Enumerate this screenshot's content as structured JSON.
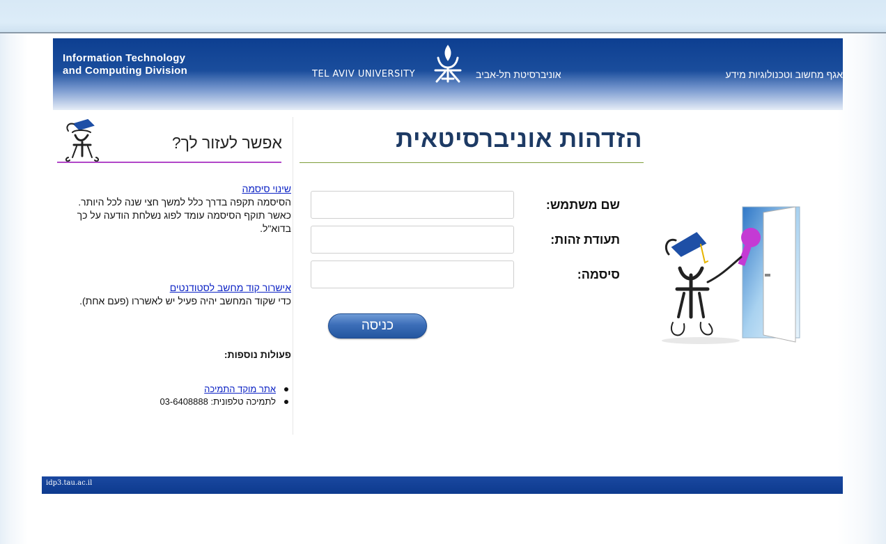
{
  "header": {
    "division_en_line1": "Information Technology",
    "division_en_line2": "and Computing Division",
    "university_en": "TEL AVIV UNIVERSITY",
    "university_he": "אוניברסיטת תל-אביב",
    "division_he": "אגף מחשוב וטכנולוגיות מידע"
  },
  "help": {
    "title": "אפשר לעזור לך?",
    "change_password_link": "שינוי סיסמה",
    "change_password_text1": "הסיסמה תקפה בדרך כלל למשך חצי שנה לכל היותר.",
    "change_password_text2": "כאשר תוקף הסיסמה עומד לפוג נשלחת הודעה על כך בדוא\"ל.",
    "computer_code_link": "אישרור קוד מחשב לסטודנטים",
    "computer_code_text": "כדי שקוד המחשב יהיה פעיל יש לאשררו (פעם אחת).",
    "more_actions_title": "פעולות נוספות:",
    "support_site_link": "אתר מוקד התמיכה",
    "phone_support": "לתמיכה טלפונית: 03-6408888"
  },
  "login": {
    "title": "הזדהות אוניברסיטאית",
    "username_label": "שם משתמש:",
    "id_label": "תעודת זהות:",
    "password_label": "סיסמה:",
    "username_value": "",
    "id_value": "",
    "password_value": "",
    "submit_label": "כניסה"
  },
  "footer": {
    "host": "idp3.tau.ac.il"
  },
  "colors": {
    "header_blue": "#0d3f91",
    "title_navy": "#1d3a64",
    "link_blue": "#0b22c4",
    "help_underline": "#b146c8",
    "title_underline": "#7d9d3a"
  },
  "icons": {
    "header_logo": "tau-logo-icon",
    "help_mascot": "mascot-icon",
    "login_art": "mascot-door-key-icon"
  }
}
